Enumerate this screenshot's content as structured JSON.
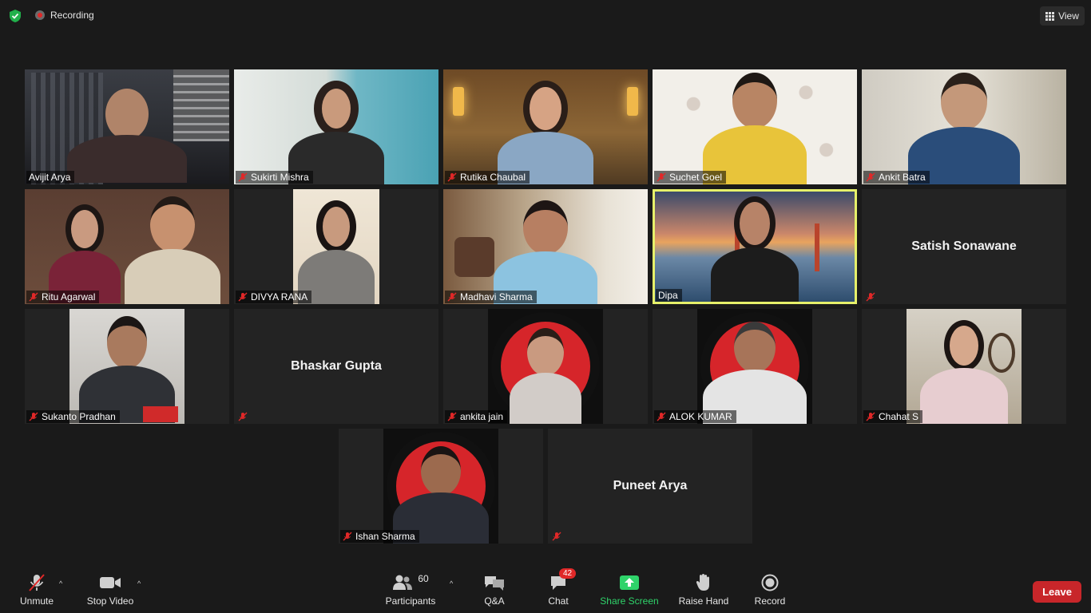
{
  "topbar": {
    "recording_label": "Recording",
    "view_label": "View",
    "colors": {
      "encryption": "#21b04b",
      "recording_dot": "#e02828"
    }
  },
  "participants": [
    {
      "name": "Avijit Arya",
      "muted": false,
      "video": true
    },
    {
      "name": "Sukirti Mishra",
      "muted": true,
      "video": true
    },
    {
      "name": "Rutika Chaubal",
      "muted": true,
      "video": true
    },
    {
      "name": "Suchet Goel",
      "muted": true,
      "video": true
    },
    {
      "name": "Ankit Batra",
      "muted": true,
      "video": true
    },
    {
      "name": "Ritu Agarwal",
      "muted": true,
      "video": true
    },
    {
      "name": "DIVYA RANA",
      "muted": true,
      "video": true
    },
    {
      "name": "Madhavi Sharma",
      "muted": true,
      "video": true
    },
    {
      "name": "Dipa",
      "muted": false,
      "video": true,
      "active_speaker": true
    },
    {
      "name": "Satish Sonawane",
      "muted": true,
      "video": false
    },
    {
      "name": "Sukanto Pradhan",
      "muted": true,
      "video": true
    },
    {
      "name": "Bhaskar Gupta",
      "muted": true,
      "video": false
    },
    {
      "name": "ankita jain",
      "muted": true,
      "video": true
    },
    {
      "name": "ALOK KUMAR",
      "muted": true,
      "video": true
    },
    {
      "name": "Chahat S",
      "muted": true,
      "video": true
    },
    {
      "name": "Ishan Sharma",
      "muted": true,
      "video": true
    },
    {
      "name": "Puneet Arya",
      "muted": true,
      "video": false
    }
  ],
  "toolbar": {
    "unmute": "Unmute",
    "stop_video": "Stop Video",
    "participants": "Participants",
    "participants_count": "60",
    "qa": "Q&A",
    "chat": "Chat",
    "chat_badge": "42",
    "share_screen": "Share Screen",
    "raise_hand": "Raise Hand",
    "record": "Record",
    "leave": "Leave",
    "colors": {
      "share": "#2fd36a",
      "leave": "#c8262a",
      "badge": "#e02828",
      "active_outline": "#e6f06a"
    }
  }
}
